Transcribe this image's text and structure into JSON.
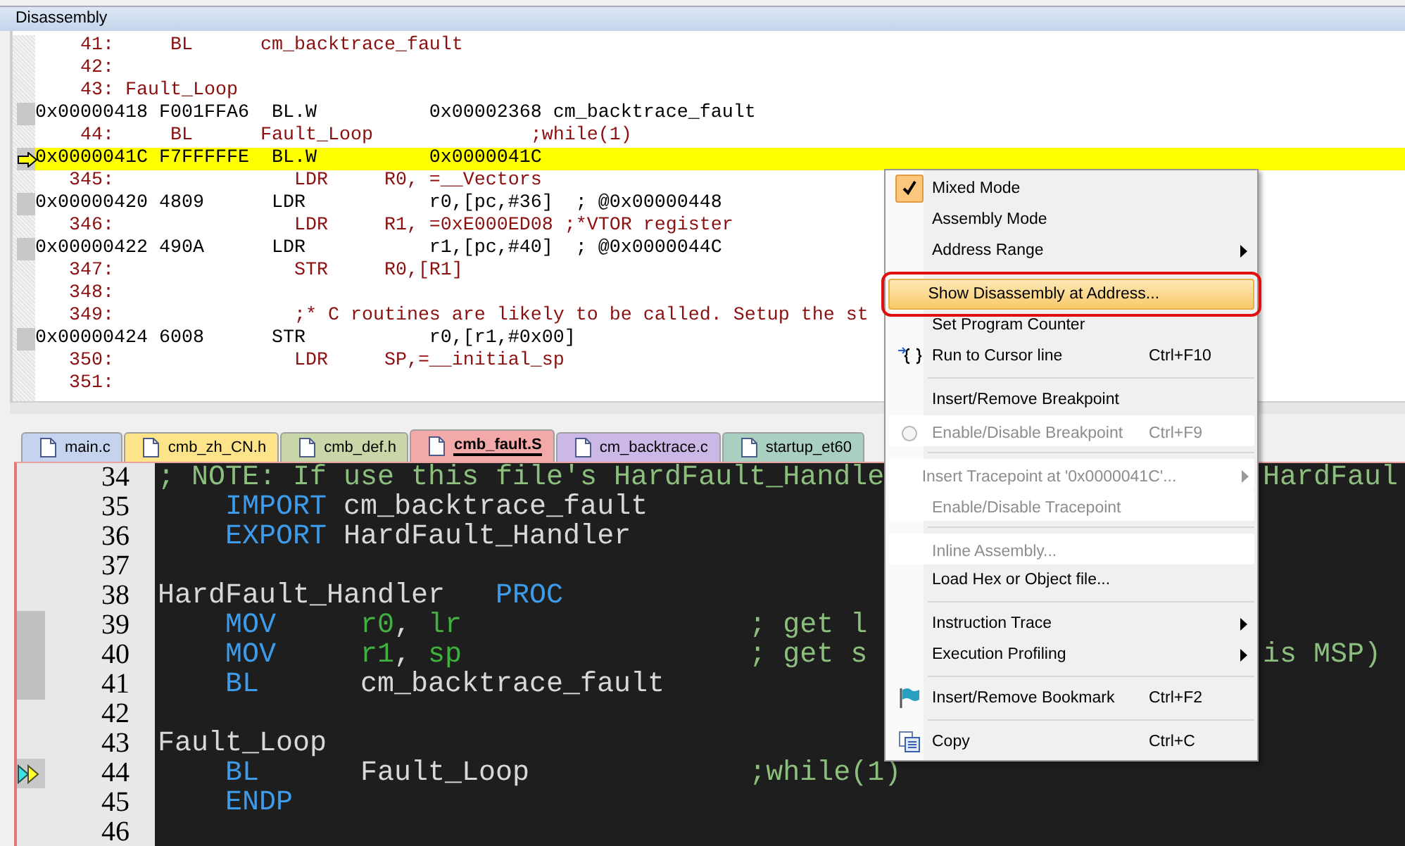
{
  "disassembly": {
    "title": "Disassembly",
    "rows": [
      {
        "kind": "source",
        "text": "    41:     BL      cm_backtrace_fault",
        "current": false
      },
      {
        "kind": "source",
        "text": "    42:",
        "current": false
      },
      {
        "kind": "source",
        "text": "    43: Fault_Loop",
        "current": false
      },
      {
        "kind": "asm",
        "text": "0x00000418 F001FFA6  BL.W          0x00002368 cm_backtrace_fault",
        "current": false
      },
      {
        "kind": "source",
        "text": "    44:     BL      Fault_Loop              ;while(1)",
        "current": false
      },
      {
        "kind": "asm",
        "text": "0x0000041C F7FFFFFE  BL.W          0x0000041C",
        "current": true
      },
      {
        "kind": "source",
        "text": "   345:                LDR     R0, =__Vectors",
        "current": false
      },
      {
        "kind": "asm",
        "text": "0x00000420 4809      LDR           r0,[pc,#36]  ; @0x00000448",
        "current": false
      },
      {
        "kind": "source",
        "text": "   346:                LDR     R1, =0xE000ED08 ;*VTOR register",
        "current": false
      },
      {
        "kind": "asm",
        "text": "0x00000422 490A      LDR           r1,[pc,#40]  ; @0x0000044C",
        "current": false
      },
      {
        "kind": "source",
        "text": "   347:                STR     R0,[R1]",
        "current": false
      },
      {
        "kind": "source",
        "text": "   348:",
        "current": false
      },
      {
        "kind": "source",
        "text": "   349:                ;* C routines are likely to be called. Setup the st",
        "current": false
      },
      {
        "kind": "asm",
        "text": "0x00000424 6008      STR           r0,[r1,#0x00]",
        "current": false
      },
      {
        "kind": "source",
        "text": "   350:                LDR     SP,=__initial_sp",
        "current": false
      },
      {
        "kind": "source",
        "text": "   351:",
        "current": false
      }
    ]
  },
  "editor": {
    "tabs": [
      {
        "label": "main.c",
        "color": "#c5d3ee",
        "selected": false
      },
      {
        "label": "cmb_zh_CN.h",
        "color": "#fde48a",
        "selected": false
      },
      {
        "label": "cmb_def.h",
        "color": "#c8d6a8",
        "selected": false
      },
      {
        "label": "cmb_fault.S",
        "color": "#f4a9a9",
        "selected": true
      },
      {
        "label": "cm_backtrace.c",
        "color": "#cbb8e6",
        "selected": false
      },
      {
        "label": "startup_et60",
        "color": "#a9cfc0",
        "selected": false
      }
    ],
    "lines": [
      {
        "number": "34",
        "marked": false,
        "current": false,
        "left": [
          {
            "kind": "comment",
            "text": "; NOTE: If use this file's HardFault_Handle"
          }
        ],
        "right": [
          {
            "kind": "comment",
            "text": "HardFaul"
          }
        ]
      },
      {
        "number": "35",
        "marked": false,
        "current": false,
        "left": [
          {
            "kind": "keyword",
            "text": "    IMPORT"
          },
          {
            "kind": "plain",
            "text": " cm_backtrace_fault"
          }
        ]
      },
      {
        "number": "36",
        "marked": false,
        "current": false,
        "left": [
          {
            "kind": "keyword",
            "text": "    EXPORT"
          },
          {
            "kind": "plain",
            "text": " HardFault_Handler"
          }
        ]
      },
      {
        "number": "37",
        "marked": false,
        "current": false
      },
      {
        "number": "38",
        "marked": false,
        "current": false,
        "left": [
          {
            "kind": "plain",
            "text": "HardFault_Handler"
          },
          {
            "kind": "keyword",
            "text": "   PROC"
          }
        ]
      },
      {
        "number": "39",
        "marked": true,
        "current": false,
        "left": [
          {
            "kind": "keyword",
            "text": "    MOV"
          },
          {
            "kind": "register",
            "text": "     r0"
          },
          {
            "kind": "plain",
            "text": ", "
          },
          {
            "kind": "register",
            "text": "lr"
          },
          {
            "kind": "comment",
            "text": "                 ; get l"
          }
        ]
      },
      {
        "number": "40",
        "marked": true,
        "current": false,
        "left": [
          {
            "kind": "keyword",
            "text": "    MOV"
          },
          {
            "kind": "register",
            "text": "     r1"
          },
          {
            "kind": "plain",
            "text": ", "
          },
          {
            "kind": "register",
            "text": "sp"
          },
          {
            "kind": "comment",
            "text": "                 ; get s"
          }
        ],
        "right": [
          {
            "kind": "comment",
            "text": "is MSP)"
          }
        ]
      },
      {
        "number": "41",
        "marked": true,
        "current": false,
        "left": [
          {
            "kind": "keyword",
            "text": "    BL"
          },
          {
            "kind": "plain",
            "text": "      cm_backtrace_fault"
          }
        ]
      },
      {
        "number": "42",
        "marked": false,
        "current": false
      },
      {
        "number": "43",
        "marked": false,
        "current": false,
        "left": [
          {
            "kind": "plain",
            "text": "Fault_Loop"
          }
        ]
      },
      {
        "number": "44",
        "marked": false,
        "current": true,
        "left": [
          {
            "kind": "keyword",
            "text": "    BL"
          },
          {
            "kind": "plain",
            "text": "      Fault_Loop"
          },
          {
            "kind": "comment",
            "text": "             ;while(1)"
          }
        ]
      },
      {
        "number": "45",
        "marked": false,
        "current": false,
        "left": [
          {
            "kind": "keyword",
            "text": "    ENDP"
          }
        ]
      },
      {
        "number": "46",
        "marked": false,
        "current": false
      }
    ]
  },
  "context_menu": {
    "items": [
      {
        "kind": "check",
        "label": "Mixed Mode",
        "checked": true,
        "disabled": false,
        "selected": false
      },
      {
        "kind": "check",
        "label": "Assembly Mode",
        "checked": false,
        "disabled": false,
        "selected": false
      },
      {
        "kind": "plain",
        "label": "Address Range",
        "disabled": false,
        "selected": false,
        "submenu": true
      },
      {
        "kind": "separator"
      },
      {
        "kind": "plain",
        "label": "Show Disassembly at Address...",
        "disabled": false,
        "selected": true,
        "annotated": true
      },
      {
        "kind": "plain",
        "label": "Set Program Counter",
        "disabled": false,
        "selected": false
      },
      {
        "kind": "run",
        "label": "Run to Cursor line",
        "shortcut": "Ctrl+F10",
        "disabled": false,
        "selected": false
      },
      {
        "kind": "separator"
      },
      {
        "kind": "plain",
        "label": "Insert/Remove Breakpoint",
        "disabled": false,
        "selected": false
      },
      {
        "kind": "radio",
        "label": "Enable/Disable Breakpoint",
        "shortcut": "Ctrl+F9",
        "disabled": true,
        "selected": false
      },
      {
        "kind": "separator"
      },
      {
        "kind": "plain",
        "label": "Insert Tracepoint at '0x0000041C'...",
        "disabled": true,
        "selected": false,
        "submenu": true
      },
      {
        "kind": "plain",
        "label": "Enable/Disable Tracepoint",
        "disabled": true,
        "selected": false
      },
      {
        "kind": "separator"
      },
      {
        "kind": "plain",
        "label": "Inline Assembly...",
        "disabled": true,
        "selected": false
      },
      {
        "kind": "plain",
        "label": "Load Hex or Object file...",
        "disabled": false,
        "selected": false
      },
      {
        "kind": "separator"
      },
      {
        "kind": "plain",
        "label": "Instruction Trace",
        "disabled": false,
        "selected": false,
        "submenu": true
      },
      {
        "kind": "plain",
        "label": "Execution Profiling",
        "disabled": false,
        "selected": false,
        "submenu": true
      },
      {
        "kind": "separator"
      },
      {
        "kind": "bookmark",
        "label": "Insert/Remove Bookmark",
        "shortcut": "Ctrl+F2",
        "disabled": false,
        "selected": false
      },
      {
        "kind": "separator"
      },
      {
        "kind": "copy",
        "label": "Copy",
        "shortcut": "Ctrl+C",
        "disabled": false,
        "selected": false
      }
    ]
  }
}
